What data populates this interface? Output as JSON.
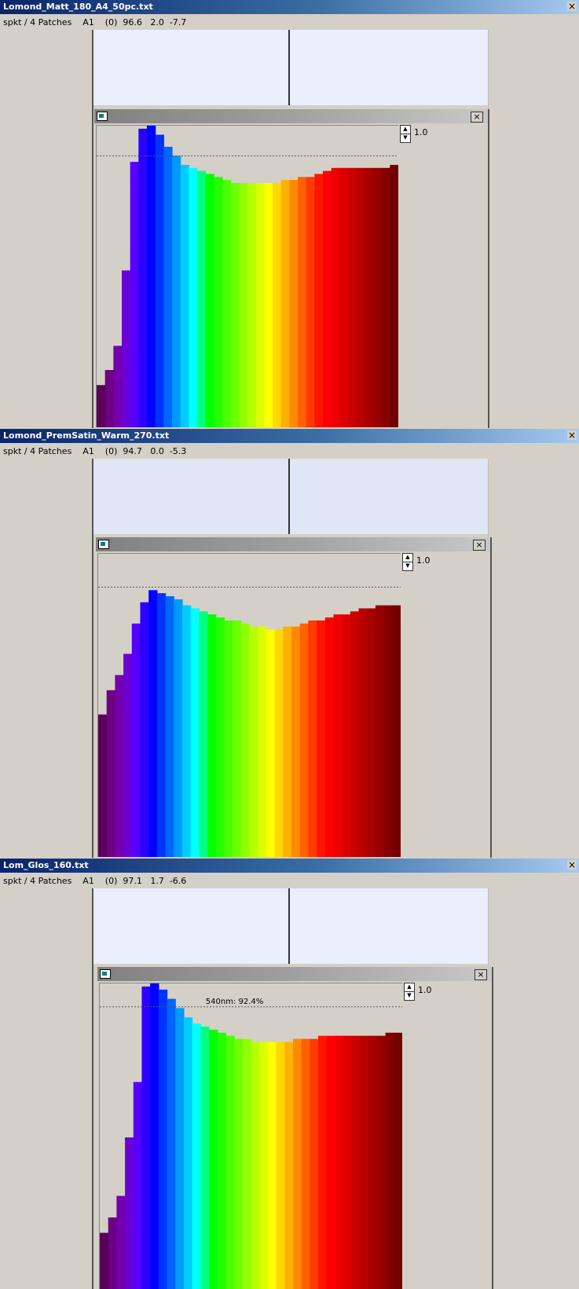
{
  "panels": [
    {
      "title": "Lomond_Matt_180_A4_50pc.txt",
      "info": "spkt / 4 Patches    A1    (0)  96.6   2.0  -7.7",
      "close_glyph": "×",
      "swatch_color": "#eaeefd",
      "chart_window": {
        "close_glyph": "×",
        "scale_label": "1.0",
        "spin_up": "▲",
        "spin_down": "▼"
      },
      "chart_data": {
        "type": "bar",
        "x": [
          380,
          390,
          400,
          410,
          420,
          430,
          440,
          450,
          460,
          470,
          480,
          490,
          500,
          510,
          520,
          530,
          540,
          550,
          560,
          570,
          580,
          590,
          600,
          610,
          620,
          630,
          640,
          650,
          660,
          670,
          680,
          690,
          700,
          710,
          720,
          730
        ],
        "values": [
          14,
          19,
          27,
          52,
          88,
          99,
          100,
          97,
          93,
          90,
          87,
          86,
          85,
          84,
          83,
          82,
          81,
          81,
          81,
          81,
          81,
          81,
          82,
          82,
          83,
          83,
          84,
          85,
          86,
          86,
          86,
          86,
          86,
          86,
          86,
          87
        ],
        "reference_line": 90,
        "ylim": [
          0,
          100
        ],
        "annotation": ""
      }
    },
    {
      "title": "Lomond_PremSatin_Warm_270.txt",
      "info": "spkt / 4 Patches    A1    (0)  94.7   0.0  -5.3",
      "close_glyph": "×",
      "swatch_color": "#dfe6f6",
      "chart_window": {
        "close_glyph": "×",
        "scale_label": "1.0",
        "spin_up": "▲",
        "spin_down": "▼"
      },
      "chart_data": {
        "type": "bar",
        "x": [
          380,
          390,
          400,
          410,
          420,
          430,
          440,
          450,
          460,
          470,
          480,
          490,
          500,
          510,
          520,
          530,
          540,
          550,
          560,
          570,
          580,
          590,
          600,
          610,
          620,
          630,
          640,
          650,
          660,
          670,
          680,
          690,
          700,
          710,
          720,
          730
        ],
        "values": [
          47,
          55,
          60,
          67,
          77,
          84,
          88,
          87,
          86,
          85,
          83,
          82,
          81,
          80,
          79,
          78,
          78,
          77,
          76,
          76,
          75,
          75,
          76,
          76,
          77,
          78,
          78,
          79,
          80,
          80,
          81,
          82,
          82,
          83,
          83,
          83
        ],
        "reference_line": 89,
        "ylim": [
          0,
          100
        ],
        "annotation": ""
      }
    },
    {
      "title": "Lom_Glos_160.txt",
      "info": "spkt / 4 Patches    A1    (0)  97.1   1.7  -6.6",
      "close_glyph": "×",
      "swatch_color": "#eaeefd",
      "chart_window": {
        "close_glyph": "×",
        "scale_label": "1.0",
        "spin_up": "▲",
        "spin_down": "▼"
      },
      "chart_data": {
        "type": "bar",
        "x": [
          380,
          390,
          400,
          410,
          420,
          430,
          440,
          450,
          460,
          470,
          480,
          490,
          500,
          510,
          520,
          530,
          540,
          550,
          560,
          570,
          580,
          590,
          600,
          610,
          620,
          630,
          640,
          650,
          660,
          670,
          680,
          690,
          700,
          710,
          720,
          730
        ],
        "values": [
          19,
          24,
          31,
          50,
          68,
          99,
          100,
          98,
          95,
          92,
          89,
          87,
          86,
          85,
          84,
          83,
          82,
          82,
          81,
          81,
          81,
          81,
          81,
          82,
          82,
          82,
          83,
          83,
          83,
          83,
          83,
          83,
          83,
          83,
          84,
          84
        ],
        "reference_line": 92.4,
        "ylim": [
          0,
          100
        ],
        "annotation": "540nm: 92.4%"
      }
    }
  ]
}
